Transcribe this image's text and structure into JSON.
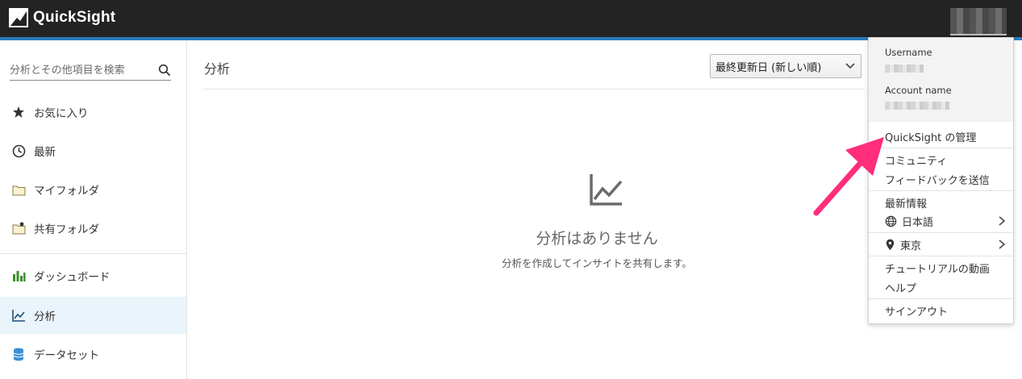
{
  "app": {
    "title": "QuickSight"
  },
  "sidebar": {
    "search_placeholder": "分析とその他項目を検索",
    "items": [
      {
        "label": "お気に入り",
        "icon": "star-icon"
      },
      {
        "label": "最新",
        "icon": "clock-icon"
      },
      {
        "label": "マイフォルダ",
        "icon": "folder-icon"
      },
      {
        "label": "共有フォルダ",
        "icon": "shared-folder-icon"
      },
      {
        "label": "ダッシュボード",
        "icon": "dashboard-icon"
      },
      {
        "label": "分析",
        "icon": "analysis-icon"
      },
      {
        "label": "データセット",
        "icon": "dataset-icon"
      }
    ]
  },
  "main": {
    "title": "分析",
    "sort_value": "最終更新日 (新しい順)",
    "empty_title": "分析はありません",
    "empty_subtitle": "分析を作成してインサイトを共有します。"
  },
  "menu": {
    "username_label": "Username",
    "account_label": "Account name",
    "items": {
      "manage": "QuickSight の管理",
      "community": "コミュニティ",
      "feedback": "フィードバックを送信",
      "whats_new": "最新情報",
      "language": "日本語",
      "region": "東京",
      "tutorials": "チュートリアルの動画",
      "help": "ヘルプ",
      "sign_out": "サインアウト"
    }
  },
  "colors": {
    "topbar": "#232323",
    "accent": "#2b7bb9",
    "active_bg": "#e9f4fb",
    "annotation": "#ff2d7a"
  }
}
